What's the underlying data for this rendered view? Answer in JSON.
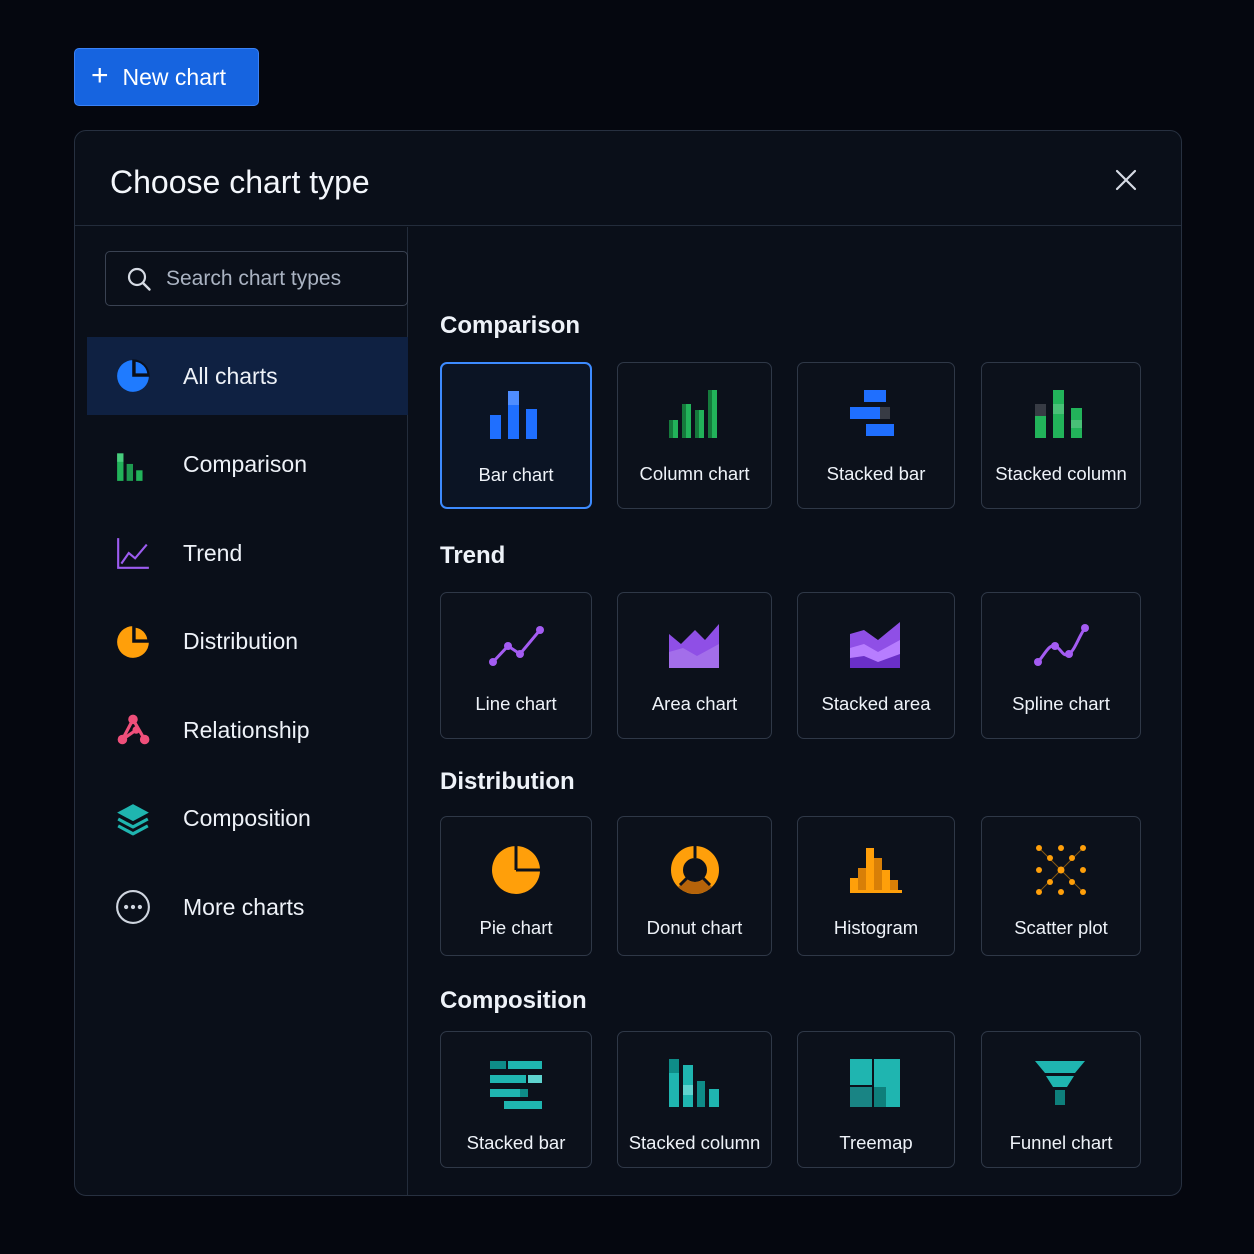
{
  "new_chart_button": {
    "label": "New chart",
    "icon": "plus-icon"
  },
  "dialog": {
    "title": "Choose chart type",
    "close_icon": "close-icon"
  },
  "search": {
    "placeholder": "Search chart types",
    "value": ""
  },
  "sidebar": {
    "items": [
      {
        "label": "All charts",
        "icon": "pie-icon",
        "color": "#1f7bff",
        "active": true
      },
      {
        "label": "Comparison",
        "icon": "bar-chart-icon",
        "color": "#22b35a"
      },
      {
        "label": "Trend",
        "icon": "line-chart-icon",
        "color": "#9c5cf0"
      },
      {
        "label": "Distribution",
        "icon": "pie-icon",
        "color": "#ff9f0a"
      },
      {
        "label": "Relationship",
        "icon": "network-icon",
        "color": "#ef4f7a"
      },
      {
        "label": "Composition",
        "icon": "layers-icon",
        "color": "#1fb5b0"
      },
      {
        "label": "More charts",
        "icon": "more-icon",
        "color": "#cfd5df"
      }
    ]
  },
  "sections": [
    {
      "title": "Comparison",
      "cards": [
        {
          "label": "Bar chart",
          "icon": "bar-chart-icon",
          "color": "#1f6fff",
          "selected": true
        },
        {
          "label": "Column chart",
          "icon": "column-chart-icon",
          "color": "#22b35a"
        },
        {
          "label": "Stacked bar",
          "icon": "stacked-bar-icon",
          "color": "#1f6fff"
        },
        {
          "label": "Stacked column",
          "icon": "stacked-column-icon",
          "color": "#22b35a"
        }
      ]
    },
    {
      "title": "Trend",
      "cards": [
        {
          "label": "Line chart",
          "icon": "line-chart-icon",
          "color": "#a45cf2"
        },
        {
          "label": "Area chart",
          "icon": "area-chart-icon",
          "color": "#8f4fe6"
        },
        {
          "label": "Stacked area",
          "icon": "stacked-area-icon",
          "color": "#8f4fe6"
        },
        {
          "label": "Spline chart",
          "icon": "spline-chart-icon",
          "color": "#a45cf2"
        }
      ]
    },
    {
      "title": "Distribution",
      "cards": [
        {
          "label": "Pie chart",
          "icon": "pie-chart-icon",
          "color": "#ff9f0a"
        },
        {
          "label": "Donut chart",
          "icon": "donut-chart-icon",
          "color": "#ff9f0a"
        },
        {
          "label": "Histogram",
          "icon": "histogram-icon",
          "color": "#ff9f0a"
        },
        {
          "label": "Scatter plot",
          "icon": "scatter-plot-icon",
          "color": "#ff9f0a"
        }
      ]
    },
    {
      "title": "Composition",
      "cards": [
        {
          "label": "Stacked bar",
          "icon": "stacked-bar-icon",
          "color": "#1fb5b0"
        },
        {
          "label": "Stacked column",
          "icon": "stacked-column-icon",
          "color": "#1fb5b0"
        },
        {
          "label": "Treemap",
          "icon": "treemap-icon",
          "color": "#1fb5b0"
        },
        {
          "label": "Funnel chart",
          "icon": "funnel-chart-icon",
          "color": "#1fb5b0"
        }
      ]
    }
  ]
}
